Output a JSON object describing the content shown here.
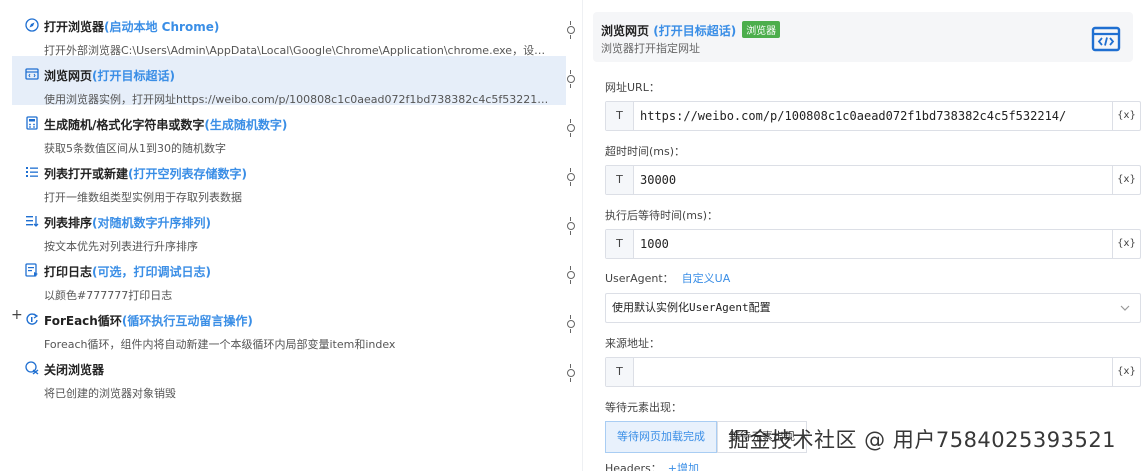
{
  "steps": [
    {
      "title": "打开浏览器",
      "hint": "(启动本地 Chrome)",
      "desc": "打开外部浏览器C:\\Users\\Admin\\AppData\\Local\\Google\\Chrome\\Application\\chrome.exe，设…",
      "icon": "compass-icon"
    },
    {
      "title": "浏览网页",
      "hint": "(打开目标超话)",
      "desc": "使用浏览器实例，打开网址https://weibo.com/p/100808c1c0aead072f1bd738382c4c5f532214/…",
      "icon": "browser-window-icon",
      "selected": true
    },
    {
      "title": "生成随机/格式化字符串或数字",
      "hint": "(生成随机数字)",
      "desc": "获取5条数值区间从1到30的随机数字",
      "icon": "calculator-icon"
    },
    {
      "title": "列表打开或新建",
      "hint": "(打开空列表存储数字)",
      "desc": "打开一维数组类型实例用于存取列表数据",
      "icon": "list-icon"
    },
    {
      "title": "列表排序",
      "hint": "(对随机数字升序排列)",
      "desc": "按文本优先对列表进行升序排序",
      "icon": "sort-list-icon"
    },
    {
      "title": "打印日志",
      "hint": "(可选，打印调试日志)",
      "desc": "以颜色#777777打印日志",
      "icon": "log-icon"
    },
    {
      "title": "ForEach循环",
      "hint": "(循环执行互动留言操作)",
      "desc": "Foreach循环，组件内将自动新建一个本级循环内局部变量item和index",
      "icon": "loop-icon",
      "expandable": true,
      "expand_label": "+"
    },
    {
      "title": "关闭浏览器",
      "hint": "",
      "desc": "将已创建的浏览器对象销毁",
      "icon": "close-browser-icon"
    }
  ],
  "panel": {
    "title": "浏览网页",
    "hint": "(打开目标超话)",
    "badge": "浏览器",
    "subtitle": "浏览器打开指定网址",
    "url_label": "网址URL：",
    "url_type": "T",
    "url_value": "https://weibo.com/p/100808c1c0aead072f1bd738382c4c5f532214/",
    "var_btn": "{x}",
    "timeout_label": "超时时间(ms)：",
    "timeout_type": "T",
    "timeout_value": "30000",
    "wait_label": "执行后等待时间(ms)：",
    "wait_type": "T",
    "wait_value": "1000",
    "ua_label": "UserAgent：",
    "ua_link": "自定义UA",
    "ua_select": "使用默认实例化UserAgent配置",
    "referer_label": "来源地址：",
    "referer_type": "T",
    "referer_value": "",
    "wait_elem_label": "等待元素出现：",
    "wait_elem_opt1": "等待网页加载完成",
    "wait_elem_opt2": "等待元素出现",
    "headers_label": "Headers：",
    "headers_add": "+增加"
  },
  "watermark": "掘金技术社区 @ 用户7584025393521"
}
